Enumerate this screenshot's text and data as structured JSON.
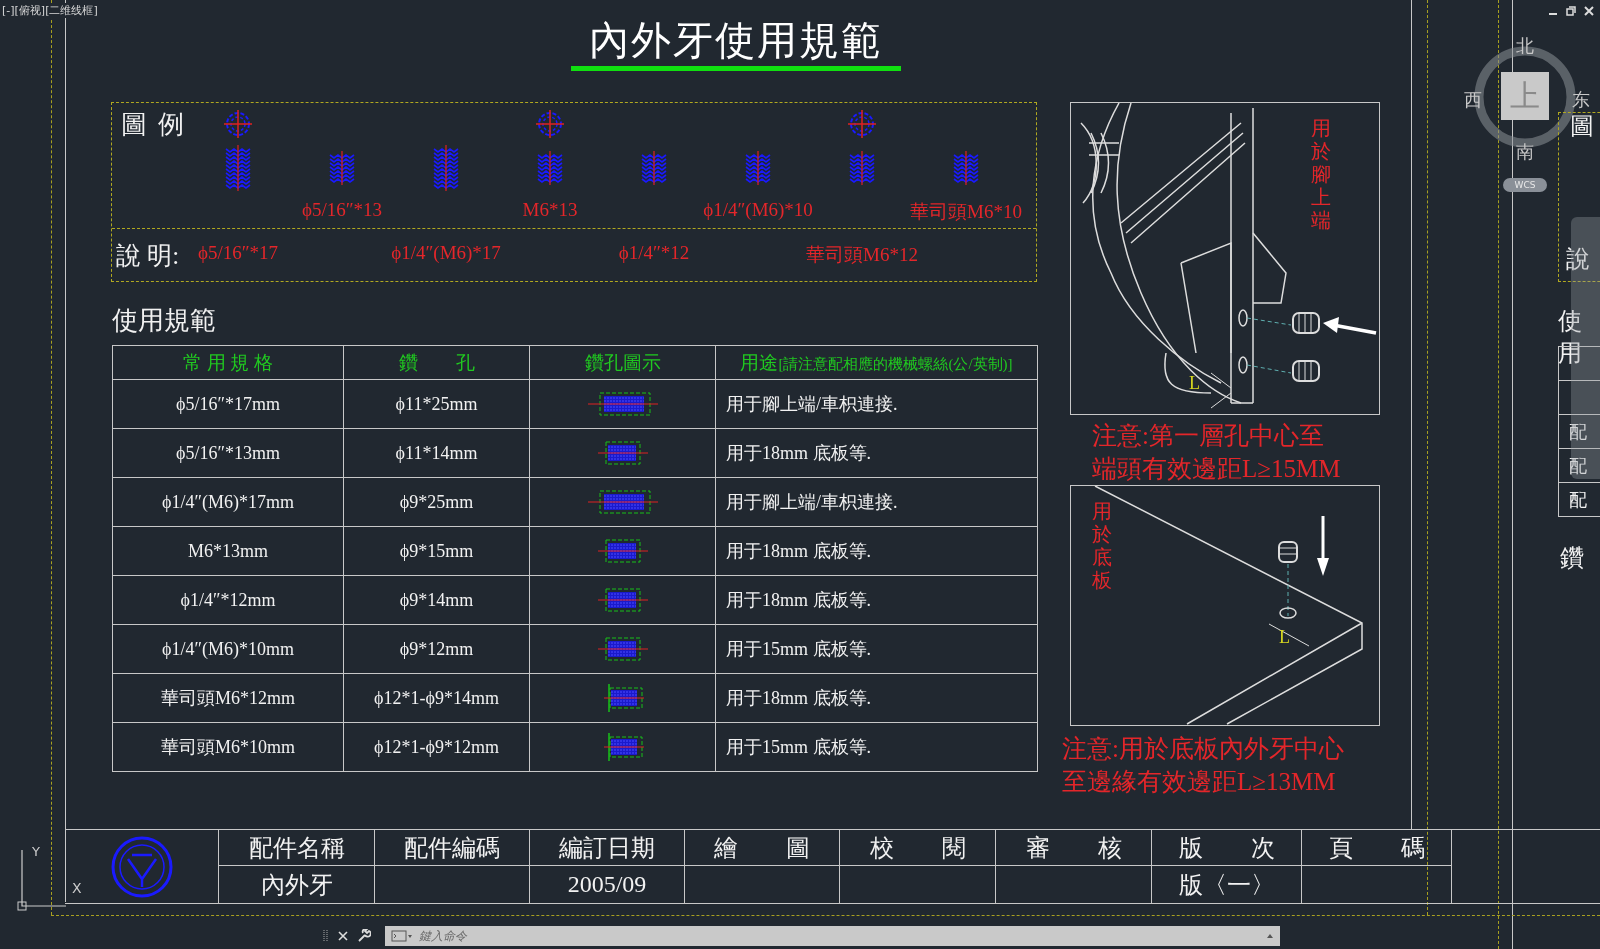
{
  "viewport_label": "[-][俯视][二维线框]",
  "title": "內外牙使用規範",
  "legend": {
    "label": "圖 例",
    "screws": [
      {
        "kind": "long",
        "top_view": true
      },
      {
        "kind": "short",
        "top_view": false
      },
      {
        "kind": "long",
        "top_view": false
      },
      {
        "kind": "short",
        "top_view": true
      },
      {
        "kind": "short",
        "top_view": false
      },
      {
        "kind": "short",
        "top_view": false
      },
      {
        "kind": "short",
        "top_view": true
      },
      {
        "kind": "short",
        "top_view": false
      }
    ],
    "captions": [
      "ϕ5/16″*13",
      "M6*13",
      "ϕ1/4″(M6)*10",
      "華司頭M6*10"
    ],
    "explanation": {
      "label": "說 明:",
      "items": [
        "ϕ5/16″*17",
        "ϕ1/4″(M6)*17",
        "ϕ1/4″*12",
        "華司頭M6*12"
      ]
    }
  },
  "section_title": "使用規範",
  "table": {
    "columns": [
      {
        "label": "常 用 規 格"
      },
      {
        "label": "鑽　　孔"
      },
      {
        "label": "鑽孔圖示"
      },
      {
        "label": "用途",
        "note": "[請注意配相應的機械螺絲(公/英制)]"
      }
    ],
    "rows": [
      {
        "spec": "ϕ5/16″*17mm",
        "drill": "ϕ11*25mm",
        "kind": "long",
        "usage": "用于腳上端/車枳連接."
      },
      {
        "spec": "ϕ5/16″*13mm",
        "drill": "ϕ11*14mm",
        "kind": "short",
        "usage": "用于18mm 底板等."
      },
      {
        "spec": "ϕ1/4″(M6)*17mm",
        "drill": "ϕ9*25mm",
        "kind": "long",
        "usage": "用于腳上端/車枳連接."
      },
      {
        "spec": "M6*13mm",
        "drill": "ϕ9*15mm",
        "kind": "short",
        "usage": "用于18mm 底板等."
      },
      {
        "spec": "ϕ1/4″*12mm",
        "drill": "ϕ9*14mm",
        "kind": "short",
        "usage": "用于18mm 底板等."
      },
      {
        "spec": "ϕ1/4″(M6)*10mm",
        "drill": "ϕ9*12mm",
        "kind": "short",
        "usage": "用于15mm 底板等."
      },
      {
        "spec": "華司頭M6*12mm",
        "drill": "ϕ12*1-ϕ9*14mm",
        "kind": "washer",
        "usage": "用于18mm 底板等."
      },
      {
        "spec": "華司頭M6*10mm",
        "drill": "ϕ12*1-ϕ9*12mm",
        "kind": "washer",
        "usage": "用于15mm 底板等."
      }
    ]
  },
  "figures": [
    {
      "kind": "leg",
      "caption": "用於腳上端",
      "dimension": "L",
      "note": [
        "注意:第一層孔中心至",
        "端頭有效邊距L≥15MM"
      ]
    },
    {
      "kind": "panel",
      "caption": "用於底板",
      "dimension": "L",
      "note": [
        "注意:用於底板內外牙中心",
        "至邊緣有效邊距L≥13MM"
      ]
    }
  ],
  "title_block": {
    "cells": [
      {
        "header": "配件名稱",
        "value": "內外牙"
      },
      {
        "header": "配件編碼"
      },
      {
        "header": "編訂日期",
        "value": "2005/09"
      },
      {
        "header": "繪　　圖"
      },
      {
        "header": "校　　閱"
      },
      {
        "header": "審　　核"
      },
      {
        "header": "版　　次",
        "value": "版〈一〉"
      },
      {
        "header": "頁　　碼"
      }
    ]
  },
  "view_cube": {
    "north": "北",
    "west": "西",
    "east": "东",
    "south": "南",
    "face": "上",
    "coordinate_system": "WCS"
  },
  "ucs": {
    "y": "Y",
    "x": "X"
  },
  "next_sheet": {
    "legend_label": "圖",
    "explanation_label": "說",
    "section_title": "使用",
    "cells": [
      "配",
      "配",
      "配"
    ],
    "heading": "鑽"
  },
  "command_line": {
    "placeholder": "鍵入命令"
  }
}
